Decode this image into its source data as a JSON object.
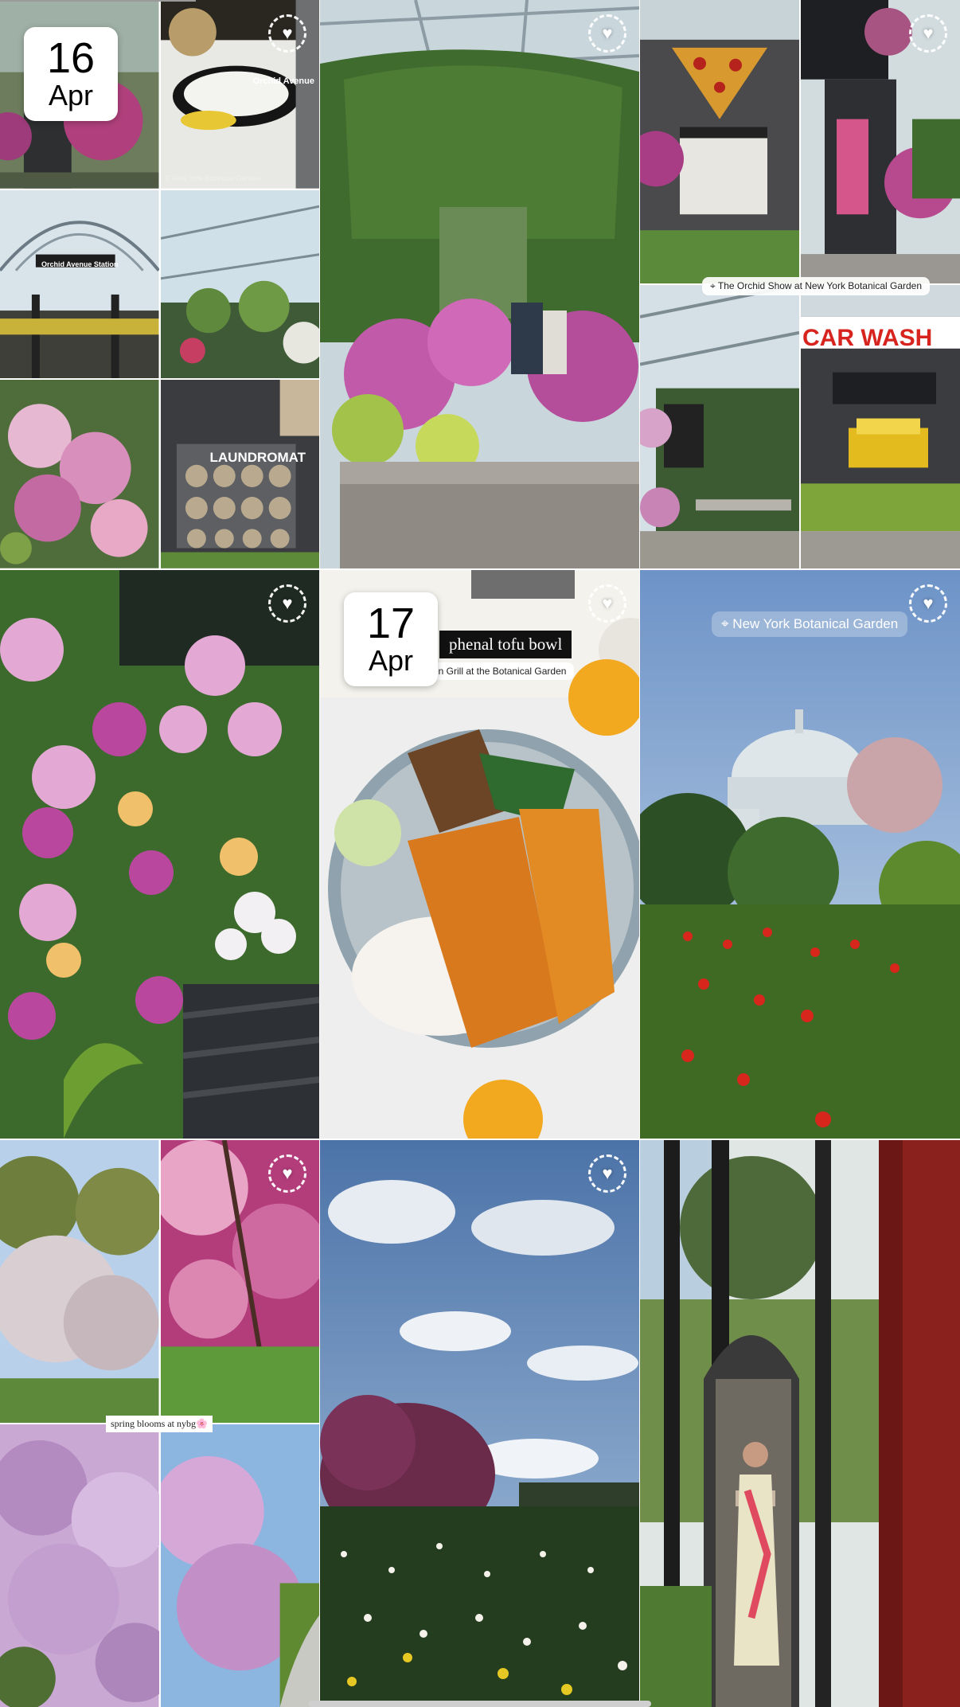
{
  "tiles": [
    {
      "date": {
        "day": "16",
        "month": "Apr"
      },
      "captions": {
        "street_sign": "Orchid Avenue",
        "watermark": "© New York Botanical Garden",
        "station_sign": "Orchid Avenue Station",
        "laundromat_sign": "LAUNDROMAT"
      }
    },
    {},
    {
      "captions": {
        "location": "The Orchid Show at New York Botanical Garden",
        "car_wash_sign": "CAR WASH"
      }
    },
    {},
    {
      "date": {
        "day": "17",
        "month": "Apr"
      },
      "captions": {
        "title": "phenal tofu bowl",
        "subtitle": "en Grill at the Botanical Garden"
      }
    },
    {
      "captions": {
        "location": "New York Botanical Garden"
      }
    },
    {
      "captions": {
        "label": "spring blooms at nybg🌸"
      }
    },
    {},
    {}
  ],
  "icons": {
    "favorite": "heart-icon",
    "location": "location-pin-icon"
  }
}
